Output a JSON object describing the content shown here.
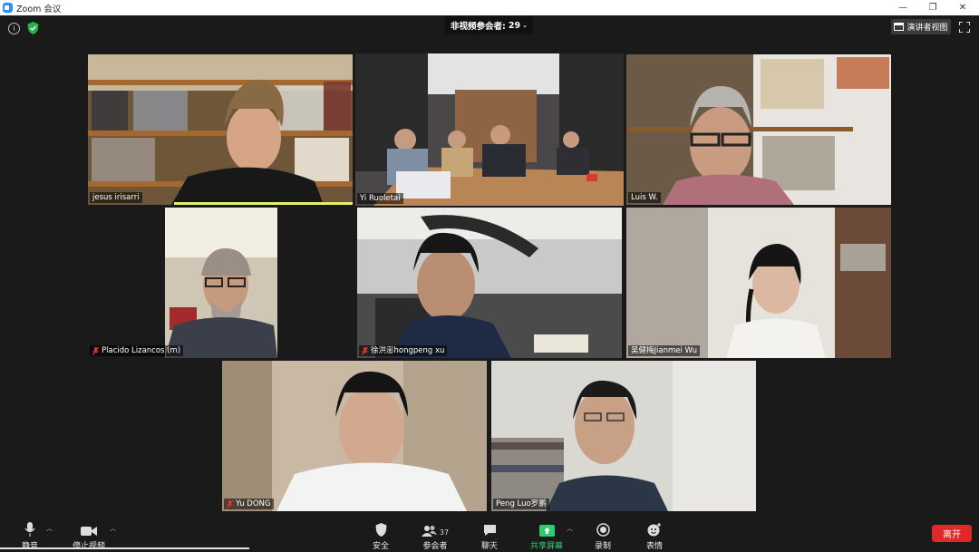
{
  "window": {
    "title": "Zoom 会议"
  },
  "top": {
    "nonvideo_label": "非视频参会者:",
    "nonvideo_count": "29",
    "speaker_view_label": "演讲者视图"
  },
  "participants": [
    {
      "name": "jesus irisarri",
      "muted": false,
      "active": false
    },
    {
      "name": "Yi Ruoletai",
      "muted": false,
      "active": true
    },
    {
      "name": "Luis W.",
      "muted": false,
      "active": false
    },
    {
      "name": "Placido Lizancos (m)",
      "muted": true,
      "active": false
    },
    {
      "name": "徐洪澎hongpeng xu",
      "muted": true,
      "active": false
    },
    {
      "name": "吴健梅Jianmei Wu",
      "muted": false,
      "active": false
    },
    {
      "name": "Yu DONG",
      "muted": true,
      "active": false
    },
    {
      "name": "Peng Luo罗鹏",
      "muted": false,
      "active": false
    }
  ],
  "toolbar": {
    "mute_label": "静音",
    "video_label": "停止视频",
    "security_label": "安全",
    "participants_label": "参会者",
    "participants_count": "37",
    "chat_label": "聊天",
    "share_label": "共享屏幕",
    "record_label": "录制",
    "reactions_label": "表情",
    "leave_label": "离开"
  },
  "colors": {
    "active_speaker": "#c7e84a",
    "share_green": "#2ecc71",
    "leave_red": "#e02828",
    "zoom_blue": "#2d8cff"
  }
}
